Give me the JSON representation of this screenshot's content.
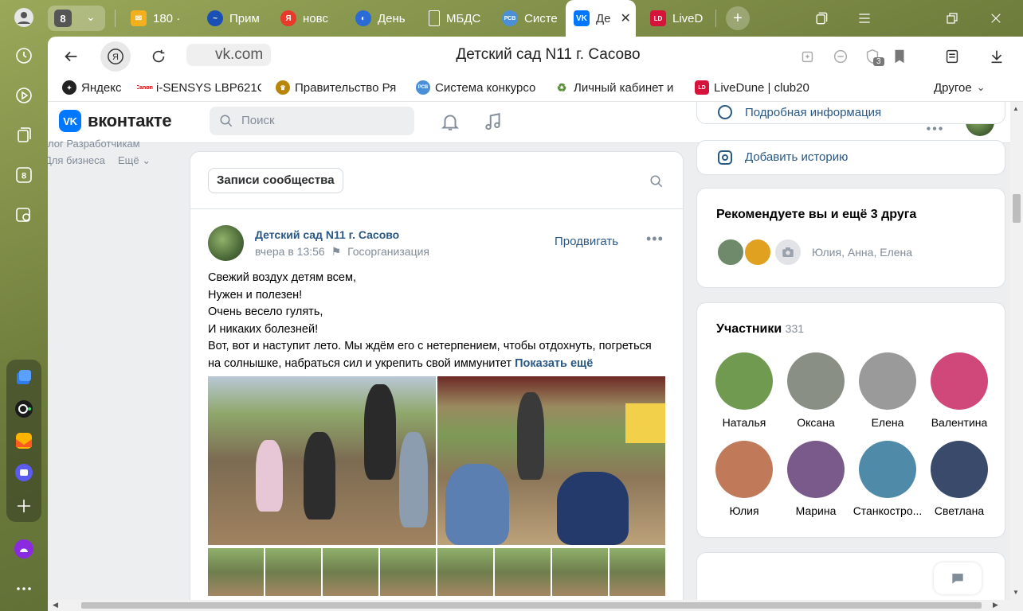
{
  "browser": {
    "tab_counter": "8",
    "tabs": [
      {
        "label": "180 ·",
        "icon": "mail-icon",
        "color": "#f2b01e"
      },
      {
        "label": "Прим",
        "icon": "wave-icon",
        "color": "#1a4fb5"
      },
      {
        "label": "новс",
        "icon": "yandex-icon",
        "color": "#e8392b"
      },
      {
        "label": "День",
        "icon": "globe-icon",
        "color": "#2a6bd6"
      },
      {
        "label": "МБДС",
        "icon": "document-icon",
        "color": "#ffffff"
      },
      {
        "label": "Систе",
        "icon": "rsv-icon",
        "color": "#4a90d9"
      },
      {
        "label": "Де",
        "icon": "vk-icon",
        "color": "#0077ff",
        "active": true
      },
      {
        "label": "LiveD",
        "icon": "livedune-icon",
        "color": "#d6133a"
      }
    ],
    "url": "vk.com",
    "page_title": "Детский сад N11 г. Сасово",
    "extensions_badge": "3",
    "bookmarks": [
      {
        "label": "Яндекс",
        "icon": "yandex-bookmark-icon",
        "color": "#222222"
      },
      {
        "label": "i-SENSYS LBP621C",
        "icon": "canon-icon",
        "color": "#cc0000"
      },
      {
        "label": "Правительство Ря",
        "icon": "emblem-icon",
        "color": "#b8860b"
      },
      {
        "label": "Система конкурсо",
        "icon": "rsv-icon",
        "color": "#4a90d9"
      },
      {
        "label": "Личный кабинет и",
        "icon": "recycle-icon",
        "color": "#5a8d3a"
      },
      {
        "label": "LiveDune | club20",
        "icon": "livedune-icon",
        "color": "#d6133a"
      }
    ],
    "bookmarks_other": "Другое"
  },
  "vk": {
    "logo_text": "вконтакте",
    "logo_mark": "VK",
    "search_placeholder": "Поиск",
    "left_nav": {
      "row1": "лог   Разработчикам",
      "row2": "Для бизнеса",
      "more": "Ещё"
    },
    "wall_button": "Записи сообщества",
    "post": {
      "author": "Детский сад N11 г. Сасово",
      "time": "вчера в 13:56",
      "category": "Госорганизация",
      "promote": "Продвигать",
      "lines": [
        "Свежий воздух детям всем,",
        "Нужен и полезен!",
        "Очень весело гулять,",
        "И никаких болезней!",
        "Вот, вот и наступит лето. Мы ждём его с нетерпением, чтобы отдохнуть, погреться",
        "на солнышке, набраться сил и укрепить свой иммунитет"
      ],
      "show_more": "Показать ещё"
    },
    "right": {
      "detailed_info": "Подробная информация",
      "add_story": "Добавить историю",
      "recommend_title": "Рекомендуете вы и ещё 3 друга",
      "recommend_names": "Юлия, Анна, Елена",
      "members_title": "Участники",
      "members_count": "331",
      "members": [
        {
          "name": "Наталья",
          "color": "#6f9a4f"
        },
        {
          "name": "Оксана",
          "color": "#8a8f86"
        },
        {
          "name": "Елена",
          "color": "#9a9a9a"
        },
        {
          "name": "Валентина",
          "color": "#d0487a"
        },
        {
          "name": "Юлия",
          "color": "#c07a5a"
        },
        {
          "name": "Марина",
          "color": "#7a5a8a"
        },
        {
          "name": "Станкостро...",
          "color": "#4f8aa8"
        },
        {
          "name": "Светлана",
          "color": "#3a4a6a"
        }
      ]
    }
  }
}
